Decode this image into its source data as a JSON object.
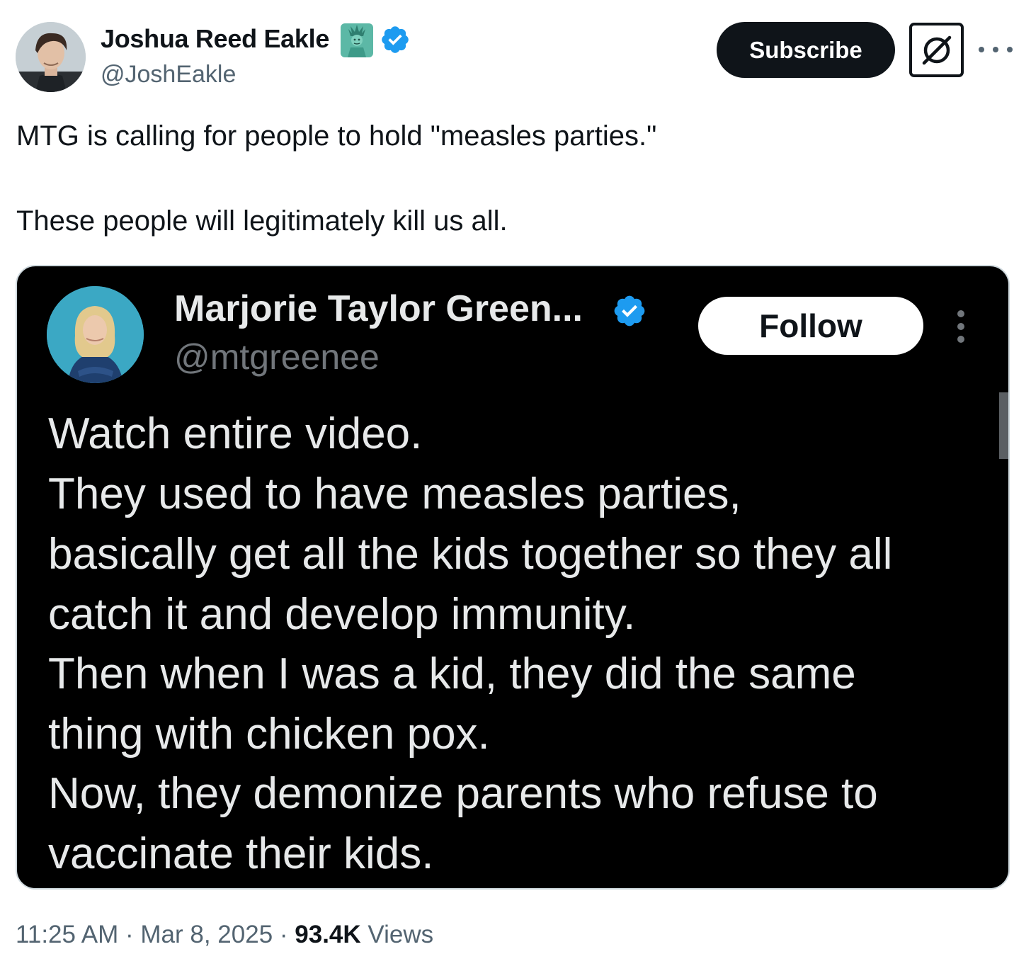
{
  "author": {
    "display_name": "Joshua Reed Eakle",
    "handle": "@JoshEakle",
    "name_emoji": "statue-of-liberty-icon",
    "verified": true
  },
  "header_actions": {
    "subscribe_label": "Subscribe",
    "grok_icon": "grok-icon",
    "more_icon": "more-horizontal-icon"
  },
  "tweet": {
    "lines": [
      "MTG is calling for people to hold \"measles parties.\"",
      "These people will legitimately kill us all."
    ]
  },
  "quoted": {
    "display_name": "Marjorie Taylor Green...",
    "handle": "@mtgreenee",
    "verified": true,
    "follow_label": "Follow",
    "more_icon": "more-vertical-icon",
    "lines": [
      "Watch entire video.",
      "They used to have measles parties,",
      "basically get all the kids together so they all",
      "catch it and develop immunity.",
      "Then when I was a kid, they did the same",
      "thing with chicken pox.",
      "Now, they demonize parents who refuse to",
      "vaccinate their kids."
    ]
  },
  "meta": {
    "time": "11:25 AM",
    "separator": " · ",
    "date": "Mar 8, 2025",
    "views_count": "93.4K",
    "views_label": " Views"
  },
  "colors": {
    "primary_text": "#0f1419",
    "secondary_text": "#536471",
    "verified_blue": "#1d9bf0",
    "dark_card": "#000000",
    "dark_text": "#e7e9ea",
    "dark_secondary": "#71767b"
  }
}
